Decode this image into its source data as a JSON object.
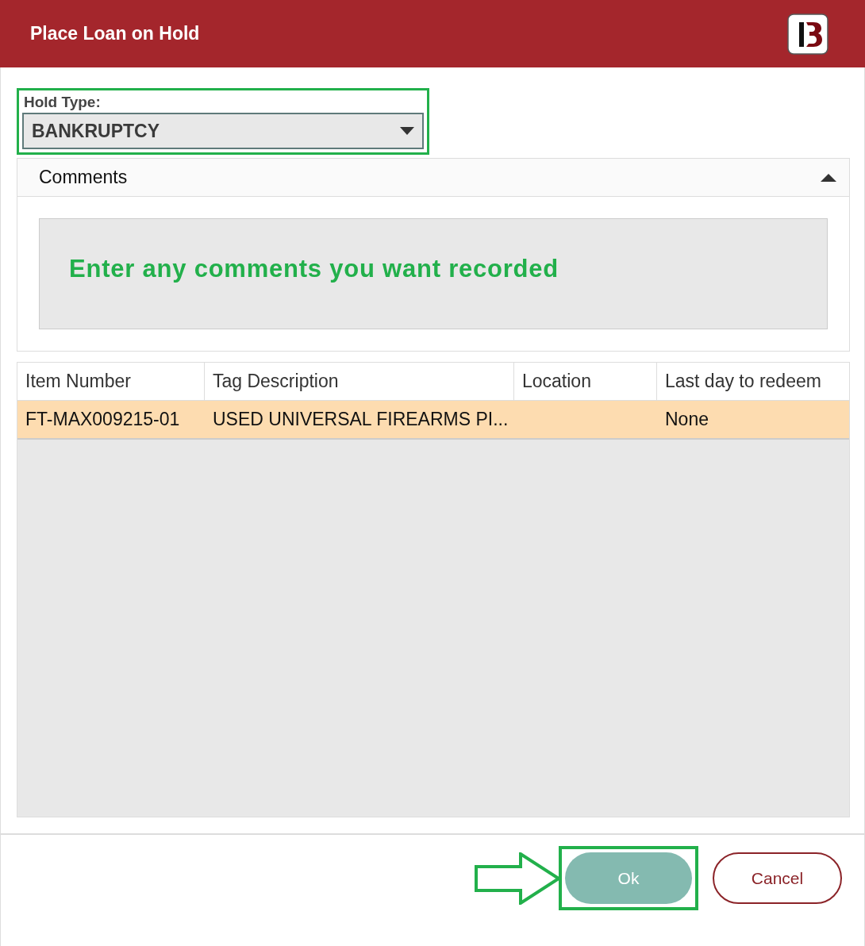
{
  "window": {
    "title": "Place Loan on Hold"
  },
  "hold_type": {
    "label": "Hold Type:",
    "value": "BANKRUPTCY",
    "highlighted": true
  },
  "comments": {
    "title": "Comments",
    "expanded": true,
    "value": "Enter any comments you want recorded"
  },
  "table": {
    "columns": [
      "Item Number",
      "Tag Description",
      "Location",
      "Last day to redeem"
    ],
    "rows": [
      {
        "cells": [
          "FT-MAX009215-01",
          "USED UNIVERSAL FIREARMS PI...",
          "",
          "None"
        ],
        "selected": true
      }
    ]
  },
  "buttons": [
    {
      "kind": "primary",
      "label": "Ok",
      "highlighted": true,
      "pointed": true
    },
    {
      "kind": "secondary",
      "label": "Cancel",
      "highlighted": false,
      "pointed": false
    }
  ]
}
